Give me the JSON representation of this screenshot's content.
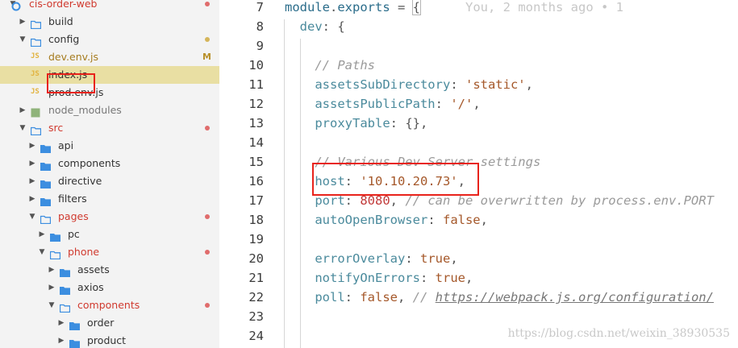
{
  "explorer": {
    "rows": [
      {
        "label": "cis-order-web",
        "depth": 0,
        "kind": "root",
        "expanded": true,
        "color": "#d03a2f",
        "dot": "#e06c6c"
      },
      {
        "label": "build",
        "depth": 1,
        "kind": "folder",
        "expanded": false,
        "color": "#333333"
      },
      {
        "label": "config",
        "depth": 1,
        "kind": "folder",
        "expanded": true,
        "color": "#333333",
        "dot": "#d5b55a"
      },
      {
        "label": "dev.env.js",
        "depth": 2,
        "kind": "js",
        "color": "#a67c1f",
        "letter": "M",
        "letter_color": "#b8902a"
      },
      {
        "label": "index.js",
        "depth": 2,
        "kind": "js",
        "color": "#333333",
        "selected": true
      },
      {
        "label": "prod.env.js",
        "depth": 2,
        "kind": "js",
        "color": "#333333"
      },
      {
        "label": "node_modules",
        "depth": 1,
        "kind": "pkg",
        "expanded": false,
        "color": "#777777"
      },
      {
        "label": "src",
        "depth": 1,
        "kind": "folder",
        "expanded": true,
        "color": "#d03a2f",
        "dot": "#e06c6c"
      },
      {
        "label": "api",
        "depth": 2,
        "kind": "bluefolder",
        "expanded": false,
        "color": "#333333"
      },
      {
        "label": "components",
        "depth": 2,
        "kind": "bluefolder",
        "expanded": false,
        "color": "#333333"
      },
      {
        "label": "directive",
        "depth": 2,
        "kind": "bluefolder",
        "expanded": false,
        "color": "#333333"
      },
      {
        "label": "filters",
        "depth": 2,
        "kind": "bluefolder",
        "expanded": false,
        "color": "#333333"
      },
      {
        "label": "pages",
        "depth": 2,
        "kind": "folder",
        "expanded": true,
        "color": "#d03a2f",
        "dot": "#e06c6c"
      },
      {
        "label": "pc",
        "depth": 3,
        "kind": "bluefolder",
        "expanded": false,
        "color": "#333333"
      },
      {
        "label": "phone",
        "depth": 3,
        "kind": "folder",
        "expanded": true,
        "color": "#d03a2f",
        "dot": "#e06c6c"
      },
      {
        "label": "assets",
        "depth": 4,
        "kind": "bluefolder",
        "expanded": false,
        "color": "#333333"
      },
      {
        "label": "axios",
        "depth": 4,
        "kind": "bluefolder",
        "expanded": false,
        "color": "#333333"
      },
      {
        "label": "components",
        "depth": 4,
        "kind": "folder",
        "expanded": true,
        "color": "#d03a2f",
        "dot": "#e06c6c"
      },
      {
        "label": "order",
        "depth": 5,
        "kind": "bluefolder",
        "expanded": false,
        "color": "#333333"
      },
      {
        "label": "product",
        "depth": 5,
        "kind": "bluefolder",
        "expanded": false,
        "color": "#333333"
      }
    ]
  },
  "editor": {
    "line_numbers": [
      "7",
      "8",
      "9",
      "10",
      "11",
      "12",
      "13",
      "14",
      "15",
      "16",
      "17",
      "18",
      "19",
      "20",
      "21",
      "22",
      "23",
      "24"
    ],
    "lines": [
      [
        {
          "t": "module",
          "c": "kw"
        },
        {
          "t": ".",
          "c": "punc"
        },
        {
          "t": "exports",
          "c": "kw"
        },
        {
          "t": " = ",
          "c": "punc"
        },
        {
          "t": "{",
          "c": "punc",
          "hl": true
        },
        {
          "t": "      You, 2 months ago • 1",
          "c": "blame"
        }
      ],
      [
        {
          "t": "  dev",
          "c": "key"
        },
        {
          "t": ": {",
          "c": "punc"
        }
      ],
      [],
      [
        {
          "t": "    // Paths",
          "c": "comment"
        }
      ],
      [
        {
          "t": "    assetsSubDirectory",
          "c": "key"
        },
        {
          "t": ": ",
          "c": "punc"
        },
        {
          "t": "'static'",
          "c": "str"
        },
        {
          "t": ",",
          "c": "punc"
        }
      ],
      [
        {
          "t": "    assetsPublicPath",
          "c": "key"
        },
        {
          "t": ": ",
          "c": "punc"
        },
        {
          "t": "'/'",
          "c": "str"
        },
        {
          "t": ",",
          "c": "punc"
        }
      ],
      [
        {
          "t": "    proxyTable",
          "c": "key"
        },
        {
          "t": ": {},",
          "c": "punc"
        }
      ],
      [],
      [
        {
          "t": "    // Various Dev Server settings",
          "c": "comment"
        }
      ],
      [
        {
          "t": "    host",
          "c": "key"
        },
        {
          "t": ": ",
          "c": "punc"
        },
        {
          "t": "'10.10.20.73'",
          "c": "str"
        },
        {
          "t": ",",
          "c": "punc"
        }
      ],
      [
        {
          "t": "    port",
          "c": "key"
        },
        {
          "t": ": ",
          "c": "punc"
        },
        {
          "t": "8080",
          "c": "num"
        },
        {
          "t": ", ",
          "c": "punc"
        },
        {
          "t": "// can be overwritten by process.env.PORT",
          "c": "comment"
        }
      ],
      [
        {
          "t": "    autoOpenBrowser",
          "c": "key"
        },
        {
          "t": ": ",
          "c": "punc"
        },
        {
          "t": "false",
          "c": "bool"
        },
        {
          "t": ",",
          "c": "punc"
        }
      ],
      [],
      [
        {
          "t": "    errorOverlay",
          "c": "key"
        },
        {
          "t": ": ",
          "c": "punc"
        },
        {
          "t": "true",
          "c": "bool"
        },
        {
          "t": ",",
          "c": "punc"
        }
      ],
      [
        {
          "t": "    notifyOnErrors",
          "c": "key"
        },
        {
          "t": ": ",
          "c": "punc"
        },
        {
          "t": "true",
          "c": "bool"
        },
        {
          "t": ",",
          "c": "punc"
        }
      ],
      [
        {
          "t": "    poll",
          "c": "key"
        },
        {
          "t": ": ",
          "c": "punc"
        },
        {
          "t": "false",
          "c": "bool"
        },
        {
          "t": ", ",
          "c": "punc"
        },
        {
          "t": "// ",
          "c": "comment"
        },
        {
          "t": "https://webpack.js.org/configuration/",
          "c": "url"
        }
      ],
      [],
      []
    ]
  },
  "watermark": "https://blog.csdn.net/weixin_38930535",
  "colors": {
    "highlight_box": "#e8231b",
    "selected_row": "#e9dfa3",
    "folder_blue": "#3c8ee0",
    "modified_red": "#d03a2f"
  }
}
